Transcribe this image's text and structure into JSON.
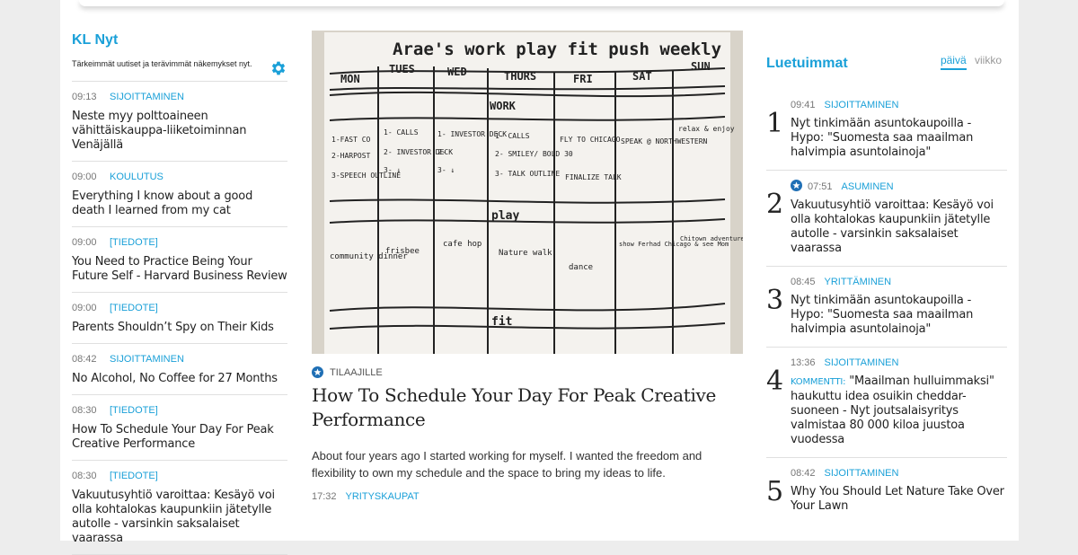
{
  "left": {
    "title": "KL Nyt",
    "subtitle": "Tärkeimmät uutiset ja terävimmät näkemykset nyt.",
    "items": [
      {
        "time": "09:13",
        "tag": "SIJOITTAMINEN",
        "headline": "Neste myy polttoaineen vähittäiskauppa-liiketoiminnan Venäjällä"
      },
      {
        "time": "09:00",
        "tag": "KOULUTUS",
        "headline": "Everything I know about a good death I learned from my cat"
      },
      {
        "time": "09:00",
        "tag": "[TIEDOTE]",
        "headline": "You Need to Practice Being Your Future Self - Harvard Business Review"
      },
      {
        "time": "09:00",
        "tag": "[TIEDOTE]",
        "headline": "Parents Shouldn’t Spy on Their Kids"
      },
      {
        "time": "08:42",
        "tag": "SIJOITTAMINEN",
        "headline": "No Alcohol, No Coffee for 27 Months"
      },
      {
        "time": "08:30",
        "tag": "[TIEDOTE]",
        "headline": "How To Schedule Your Day For Peak Creative Performance"
      },
      {
        "time": "08:30",
        "tag": "[TIEDOTE]",
        "headline": "Vakuutusyhtiö varoittaa: Kesäyö voi olla kohtalokas kaupunkiin jätetylle autolle - varsinkin saksalaiset vaarassa"
      }
    ]
  },
  "main": {
    "label": "TILAAJILLE",
    "title": "How To Schedule Your Day For Peak Creative Performance",
    "lede": "About four years ago I started working for myself. I wanted the freedom and flexibility to own my schedule and the space to bring my ideas to life.",
    "time": "17:32",
    "tag": "YRITYSKAUPAT",
    "image": {
      "heading": "Arae's work play fit push weekly",
      "days": [
        "MON",
        "TUES",
        "WED",
        "THURS",
        "FRI",
        "SAT",
        "SUN"
      ],
      "row_work": "WORK",
      "row_play": "play",
      "row_fit": "fit",
      "work_cells": [
        [
          "1-FAST CO",
          "2-HARPOST",
          "3-SPEECH OUTLINE"
        ],
        [
          "1- CALLS",
          "2- INVESTOR DECK",
          "3- ↓"
        ],
        [
          "1- INVESTOR DECK",
          "2-",
          "3-  ↓"
        ],
        [
          "1- CALLS",
          "2- SMILEY/ BOLD 30",
          "3- TALK OUTLINE"
        ],
        [
          "FLY TO CHICAGO",
          "FINALIZE TALK"
        ],
        [
          "SPEAK @ NORTHWESTERN"
        ],
        [
          "relax & enjoy"
        ]
      ],
      "play_cells": [
        "community dinner",
        "frisbee",
        "cafe hop",
        "Nature walk",
        "dance",
        "show Ferhad Chicago & see Mom",
        "Chitown adventure"
      ]
    }
  },
  "right": {
    "title": "Luetuimmat",
    "tabs": {
      "day": "päivä",
      "week": "viikko"
    },
    "items": [
      {
        "rank": "1",
        "time": "09:41",
        "tag": "SIJOITTAMINEN",
        "prefix": "",
        "headline": "Nyt tinkimään asuntokaupoilla - Hypo: \"Suomesta saa maailman halvimpia asuntolainoja\""
      },
      {
        "rank": "2",
        "time": "07:51",
        "tag": "ASUMINEN",
        "prefix": "",
        "headline": "Vakuutusyhtiö varoittaa: Kesäyö voi olla kohtalokas kaupunkiin jätetylle autolle - varsinkin saksalaiset vaarassa"
      },
      {
        "rank": "3",
        "time": "08:45",
        "tag": "YRITTÄMINEN",
        "prefix": "",
        "headline": "Nyt tinkimään asuntokaupoilla - Hypo: \"Suomesta saa maailman halvimpia asuntolainoja\""
      },
      {
        "rank": "4",
        "time": "13:36",
        "tag": "SIJOITTAMINEN",
        "prefix": "KOMMENTTI:",
        "headline": "\"Maailman hulluimmaksi\" haukuttu idea osuikin cheddar-suoneen - Nyt joutsalaisyritys valmistaa 80 000 kiloa juustoa vuodessa"
      },
      {
        "rank": "5",
        "time": "08:42",
        "tag": "SIJOITTAMINEN",
        "prefix": "",
        "headline": "Why You Should Let Nature Take Over Your Lawn"
      }
    ]
  },
  "colors": {
    "accent": "#1aa0d8",
    "text": "#222222",
    "divider": "#e0e0e0"
  },
  "icons": {
    "settings": "gear-icon",
    "subscriber": "star-badge-icon"
  }
}
